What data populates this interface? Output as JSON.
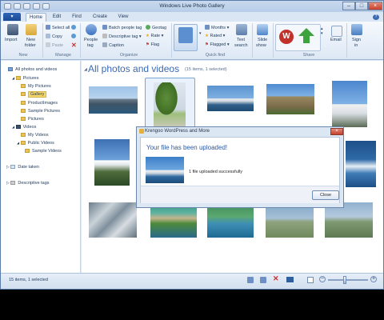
{
  "window": {
    "title": "Windows Live Photo Gallery"
  },
  "tabs": [
    "Home",
    "Edit",
    "Find",
    "Create",
    "View"
  ],
  "ribbon": {
    "new": {
      "import": "Import",
      "new_folder_1": "New",
      "new_folder_2": "folder",
      "label": "New"
    },
    "manage": {
      "select_all": "Select all",
      "copy": "Copy",
      "paste": "Paste",
      "label": "Manage"
    },
    "organize": {
      "people_tag_1": "People",
      "people_tag_2": "tag",
      "batch": "Batch people tag",
      "descriptive": "Descriptive tag",
      "caption": "Caption",
      "geotag": "Geotag",
      "rate": "Rate",
      "flag": "Flag",
      "label": "Organize"
    },
    "quickfind": {
      "months": "Months",
      "rated": "Rated",
      "flagged": "Flagged",
      "text_search_1": "Text",
      "text_search_2": "search",
      "label": "Quick find"
    },
    "slideshow": {
      "l1": "Slide",
      "l2": "show"
    },
    "share": {
      "email": "Email",
      "signin_1": "Sign",
      "signin_2": "in",
      "label": "Share"
    }
  },
  "nav": {
    "all": "All photos and videos",
    "pictures": "Pictures",
    "my_pictures": "My Pictures",
    "gallery": "Gallery",
    "product_images": "ProductImages",
    "sample_pictures": "Sample Pictures",
    "pictures2": "Pictures",
    "videos": "Videos",
    "my_videos": "My Videos",
    "public_videos": "Public Videos",
    "sample_videos": "Sample Videos",
    "date_taken": "Date taken",
    "descriptive_tags": "Descriptive tags"
  },
  "main": {
    "heading": "All photos and videos",
    "count": "(15 items, 1 selected)"
  },
  "status": {
    "text": "15 items, 1 selected"
  },
  "dialog": {
    "title": "Krengoo WordPress and More",
    "heading": "Your file has been uploaded!",
    "message": "1 file uploaded successfully",
    "close": "Close"
  },
  "colors": {
    "accent": "#3a6ab2",
    "selection": "#f6d76a",
    "file_tab": "#2e66b8"
  }
}
